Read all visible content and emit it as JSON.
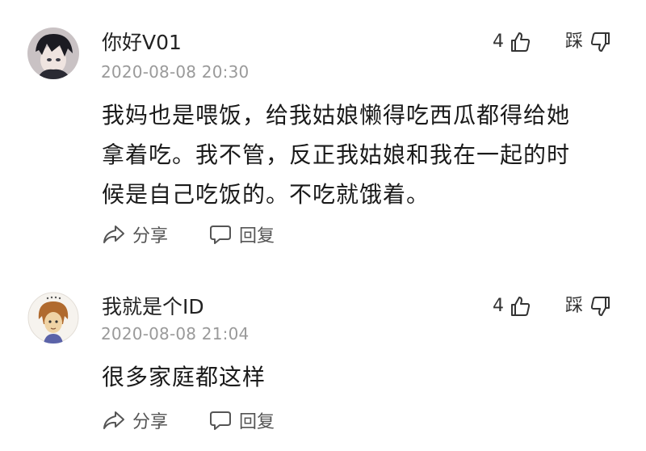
{
  "comments": [
    {
      "username": "你好V01",
      "timestamp": "2020-08-08 20:30",
      "likes": "4",
      "dislike_label": "踩",
      "lines": [
        "我妈也是喂饭，给我姑娘懒得吃西瓜都得给她",
        "拿着吃。我不管，反正我姑娘和我在一起的时",
        "候是自己吃饭的。不吃就饿着。"
      ],
      "share_label": "分享",
      "reply_label": "回复"
    },
    {
      "username": "我就是个ID",
      "timestamp": "2020-08-08 21:04",
      "likes": "4",
      "dislike_label": "踩",
      "lines": [
        "很多家庭都这样"
      ],
      "share_label": "分享",
      "reply_label": "回复"
    }
  ],
  "colors": {
    "timestamp": "#9a9a9a",
    "text": "#1a1a1a",
    "action": "#555555"
  }
}
